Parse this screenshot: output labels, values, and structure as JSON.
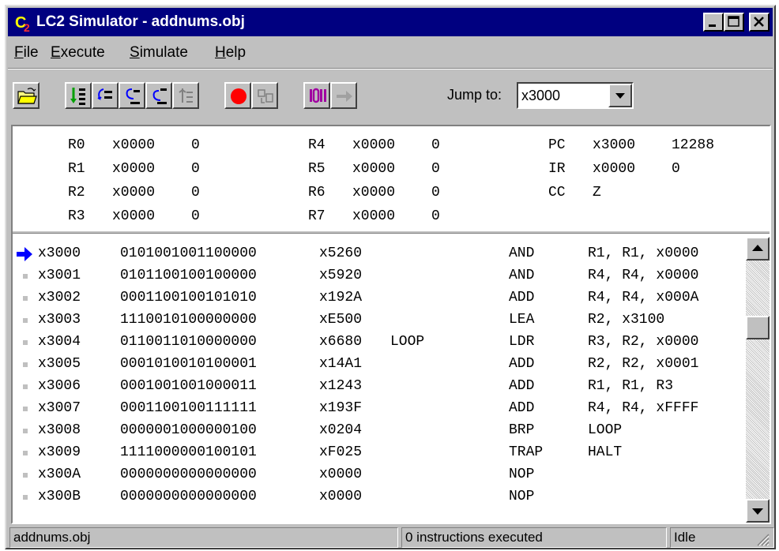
{
  "window": {
    "title": "LC2 Simulator - addnums.obj"
  },
  "menu": [
    {
      "label": "File",
      "mnemonic": "F",
      "rest": "ile"
    },
    {
      "label": "Execute",
      "mnemonic": "E",
      "rest": "xecute"
    },
    {
      "label": "Simulate",
      "mnemonic": "S",
      "rest": "imulate"
    },
    {
      "label": "Help",
      "mnemonic": "H",
      "rest": "elp"
    }
  ],
  "toolbar": {
    "jump_label": "Jump to:",
    "jump_value": "x3000",
    "icons": [
      "open-folder-icon",
      "run-icon",
      "step-over-icon",
      "step-into-icon",
      "step-out-icon",
      "disabled-step-icon",
      "stop-icon",
      "disabled-run-to-icon",
      "console-icon",
      "disabled-arrow-icon"
    ]
  },
  "registers": [
    {
      "name": "R0",
      "hex": "x0000",
      "dec": "0"
    },
    {
      "name": "R1",
      "hex": "x0000",
      "dec": "0"
    },
    {
      "name": "R2",
      "hex": "x0000",
      "dec": "0"
    },
    {
      "name": "R3",
      "hex": "x0000",
      "dec": "0"
    },
    {
      "name": "R4",
      "hex": "x0000",
      "dec": "0"
    },
    {
      "name": "R5",
      "hex": "x0000",
      "dec": "0"
    },
    {
      "name": "R6",
      "hex": "x0000",
      "dec": "0"
    },
    {
      "name": "R7",
      "hex": "x0000",
      "dec": "0"
    }
  ],
  "special_registers": [
    {
      "name": "PC",
      "hex": "x3000",
      "dec": "12288"
    },
    {
      "name": "IR",
      "hex": "x0000",
      "dec": "0"
    },
    {
      "name": "CC",
      "hex": "Z",
      "dec": ""
    }
  ],
  "memory": [
    {
      "addr": "x3000",
      "bin": "0101001001100000",
      "hex": "x5260",
      "label": "",
      "op": "AND",
      "args": "R1, R1, x0000",
      "current": true
    },
    {
      "addr": "x3001",
      "bin": "0101100100100000",
      "hex": "x5920",
      "label": "",
      "op": "AND",
      "args": "R4, R4, x0000",
      "current": false
    },
    {
      "addr": "x3002",
      "bin": "0001100100101010",
      "hex": "x192A",
      "label": "",
      "op": "ADD",
      "args": "R4, R4, x000A",
      "current": false
    },
    {
      "addr": "x3003",
      "bin": "1110010100000000",
      "hex": "xE500",
      "label": "",
      "op": "LEA",
      "args": "R2, x3100",
      "current": false
    },
    {
      "addr": "x3004",
      "bin": "0110011010000000",
      "hex": "x6680",
      "label": "LOOP",
      "op": "LDR",
      "args": "R3, R2, x0000",
      "current": false
    },
    {
      "addr": "x3005",
      "bin": "0001010010100001",
      "hex": "x14A1",
      "label": "",
      "op": "ADD",
      "args": "R2, R2, x0001",
      "current": false
    },
    {
      "addr": "x3006",
      "bin": "0001001001000011",
      "hex": "x1243",
      "label": "",
      "op": "ADD",
      "args": "R1, R1, R3",
      "current": false
    },
    {
      "addr": "x3007",
      "bin": "0001100100111111",
      "hex": "x193F",
      "label": "",
      "op": "ADD",
      "args": "R4, R4, xFFFF",
      "current": false
    },
    {
      "addr": "x3008",
      "bin": "0000001000000100",
      "hex": "x0204",
      "label": "",
      "op": "BRP",
      "args": "LOOP",
      "current": false
    },
    {
      "addr": "x3009",
      "bin": "1111000000100101",
      "hex": "xF025",
      "label": "",
      "op": "TRAP",
      "args": "HALT",
      "current": false
    },
    {
      "addr": "x300A",
      "bin": "0000000000000000",
      "hex": "x0000",
      "label": "",
      "op": "NOP",
      "args": "",
      "current": false
    },
    {
      "addr": "x300B",
      "bin": "0000000000000000",
      "hex": "x0000",
      "label": "",
      "op": "NOP",
      "args": "",
      "current": false
    }
  ],
  "status": {
    "file": "addnums.obj",
    "executed": "0 instructions executed",
    "state": "Idle"
  },
  "colors": {
    "title_bg": "#000080",
    "face": "#c0c0c0",
    "pc_arrow": "#0000ff"
  }
}
